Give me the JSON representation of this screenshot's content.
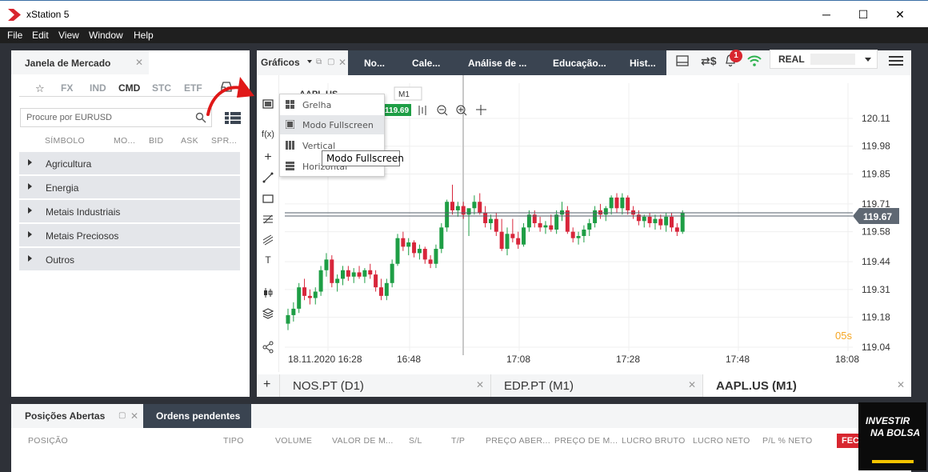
{
  "window": {
    "title": "xStation 5",
    "minimize": "─",
    "maximize": "☐",
    "close": "✕"
  },
  "menu": [
    "File",
    "Edit",
    "View",
    "Window",
    "Help"
  ],
  "market": {
    "title": "Janela de Mercado",
    "categories": [
      "☆",
      "FX",
      "IND",
      "CMD",
      "STC",
      "ETF"
    ],
    "active_category": "CMD",
    "search_placeholder": "Procure por EURUSD",
    "columns": [
      "SÍMBOLO",
      "MO...",
      "BID",
      "ASK",
      "SPR..."
    ],
    "groups": [
      "Agricultura",
      "Energia",
      "Metais Industriais",
      "Metais Preciosos",
      "Outros"
    ]
  },
  "chart_tabs": {
    "graficos": "Gráficos",
    "tabs": [
      "No...",
      "Cale...",
      "Análise de ...",
      "Educação...",
      "Hist..."
    ]
  },
  "topright": {
    "notifications": "1",
    "account_type": "REAL"
  },
  "chart_toolbar": {
    "symbol": "AAPL.US",
    "timeframe": "M1",
    "fx": "f(x)",
    "price_tag": "119.69",
    "text_tool": "T"
  },
  "dropdown": {
    "items": [
      "Grelha",
      "Modo Fullscreen",
      "Vertical",
      "Horizontal"
    ],
    "tooltip": "Modo Fullscreen"
  },
  "chart_data": {
    "type": "candlestick",
    "symbol": "AAPL.US",
    "timeframe": "M1",
    "y_ticks": [
      120.11,
      119.98,
      119.85,
      119.71,
      119.58,
      119.44,
      119.31,
      119.18,
      119.04
    ],
    "ylim": [
      119.04,
      120.11
    ],
    "x_ticks": [
      "18.11.2020 16:28",
      "16:48",
      "17:08",
      "17:28",
      "17:48",
      "18:08"
    ],
    "current_price": "119.67",
    "countdown": "05s",
    "up_color": "#1e9e45",
    "down_color": "#d8263b",
    "candles": [
      [
        119.15,
        119.22,
        119.12,
        119.19
      ],
      [
        119.19,
        119.25,
        119.16,
        119.22
      ],
      [
        119.22,
        119.34,
        119.2,
        119.32
      ],
      [
        119.32,
        119.36,
        119.26,
        119.28
      ],
      [
        119.28,
        119.31,
        119.24,
        119.27
      ],
      [
        119.27,
        119.32,
        119.24,
        119.3
      ],
      [
        119.3,
        119.42,
        119.28,
        119.4
      ],
      [
        119.4,
        119.48,
        119.37,
        119.45
      ],
      [
        119.45,
        119.47,
        119.32,
        119.34
      ],
      [
        119.34,
        119.38,
        119.3,
        119.36
      ],
      [
        119.36,
        119.42,
        119.33,
        119.4
      ],
      [
        119.4,
        119.42,
        119.35,
        119.37
      ],
      [
        119.37,
        119.41,
        119.34,
        119.39
      ],
      [
        119.39,
        119.42,
        119.36,
        119.37
      ],
      [
        119.37,
        119.41,
        119.34,
        119.4
      ],
      [
        119.4,
        119.43,
        119.36,
        119.38
      ],
      [
        119.38,
        119.4,
        119.3,
        119.32
      ],
      [
        119.32,
        119.36,
        119.26,
        119.28
      ],
      [
        119.28,
        119.36,
        119.26,
        119.34
      ],
      [
        119.34,
        119.45,
        119.32,
        119.43
      ],
      [
        119.43,
        119.57,
        119.42,
        119.55
      ],
      [
        119.55,
        119.58,
        119.49,
        119.51
      ],
      [
        119.51,
        119.55,
        119.47,
        119.53
      ],
      [
        119.53,
        119.54,
        119.46,
        119.48
      ],
      [
        119.48,
        119.52,
        119.45,
        119.5
      ],
      [
        119.5,
        119.51,
        119.43,
        119.45
      ],
      [
        119.45,
        119.47,
        119.41,
        119.43
      ],
      [
        119.43,
        119.52,
        119.41,
        119.5
      ],
      [
        119.5,
        119.62,
        119.48,
        119.6
      ],
      [
        119.6,
        119.73,
        119.58,
        119.72
      ],
      [
        119.72,
        119.8,
        119.66,
        119.68
      ],
      [
        119.68,
        119.72,
        119.65,
        119.7
      ],
      [
        119.7,
        119.72,
        119.64,
        119.66
      ],
      [
        119.66,
        119.68,
        119.56,
        119.69
      ],
      [
        119.69,
        119.75,
        119.66,
        119.72
      ],
      [
        119.72,
        119.76,
        119.66,
        119.67
      ],
      [
        119.67,
        119.7,
        119.6,
        119.62
      ],
      [
        119.62,
        119.66,
        119.59,
        119.64
      ],
      [
        119.64,
        119.67,
        119.56,
        119.58
      ],
      [
        119.58,
        119.64,
        119.49,
        119.5
      ],
      [
        119.5,
        119.6,
        119.47,
        119.57
      ],
      [
        119.57,
        119.64,
        119.53,
        119.55
      ],
      [
        119.55,
        119.58,
        119.5,
        119.52
      ],
      [
        119.52,
        119.62,
        119.51,
        119.6
      ],
      [
        119.6,
        119.68,
        119.58,
        119.66
      ],
      [
        119.66,
        119.68,
        119.6,
        119.62
      ],
      [
        119.62,
        119.65,
        119.58,
        119.6
      ],
      [
        119.6,
        119.63,
        119.57,
        119.61
      ],
      [
        119.61,
        119.66,
        119.58,
        119.59
      ],
      [
        119.59,
        119.68,
        119.57,
        119.66
      ],
      [
        119.66,
        119.72,
        119.63,
        119.68
      ],
      [
        119.68,
        119.7,
        119.57,
        119.58
      ],
      [
        119.58,
        119.6,
        119.53,
        119.55
      ],
      [
        119.55,
        119.58,
        119.52,
        119.56
      ],
      [
        119.56,
        119.61,
        119.53,
        119.59
      ],
      [
        119.59,
        119.64,
        119.56,
        119.62
      ],
      [
        119.62,
        119.7,
        119.6,
        119.68
      ],
      [
        119.68,
        119.71,
        119.64,
        119.66
      ],
      [
        119.66,
        119.7,
        119.63,
        119.69
      ],
      [
        119.69,
        119.75,
        119.66,
        119.74
      ],
      [
        119.74,
        119.76,
        119.67,
        119.69
      ],
      [
        119.69,
        119.76,
        119.66,
        119.74
      ],
      [
        119.74,
        119.75,
        119.66,
        119.68
      ],
      [
        119.68,
        119.7,
        119.64,
        119.66
      ],
      [
        119.66,
        119.68,
        119.61,
        119.63
      ],
      [
        119.63,
        119.66,
        119.6,
        119.65
      ],
      [
        119.65,
        119.67,
        119.6,
        119.62
      ],
      [
        119.62,
        119.66,
        119.59,
        119.64
      ],
      [
        119.64,
        119.66,
        119.59,
        119.61
      ],
      [
        119.61,
        119.67,
        119.58,
        119.65
      ],
      [
        119.65,
        119.67,
        119.58,
        119.6
      ],
      [
        119.6,
        119.62,
        119.56,
        119.58
      ],
      [
        119.58,
        119.68,
        119.57,
        119.67
      ]
    ]
  },
  "bottom_tabs": [
    {
      "label": "NOS.PT (D1)",
      "close": "✕"
    },
    {
      "label": "EDP.PT (M1)",
      "close": "✕"
    },
    {
      "label": "AAPL.US (M1)",
      "close": "✕"
    }
  ],
  "positions": {
    "tab1": "Posições Abertas",
    "tab2": "Ordens pendentes",
    "columns": [
      "POSIÇÃO",
      "TIPO",
      "VOLUME",
      "VALOR DE M...",
      "S/L",
      "T/P",
      "PREÇO ABER...",
      "PREÇO DE M...",
      "LUCRO BRUTO",
      "LUCRO NETO",
      "P/L % NETO"
    ],
    "close_button": "FEC"
  },
  "badge": {
    "line1": "INVESTIR",
    "line2": "NA BOLSA"
  }
}
